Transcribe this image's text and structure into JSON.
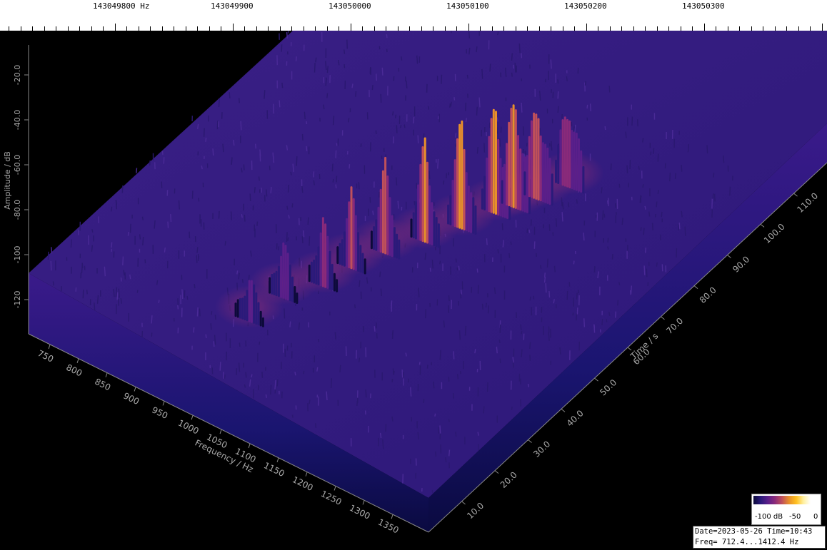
{
  "colors": {
    "background": "#000000",
    "colormap": [
      "#0c0a3a",
      "#2a1a7a",
      "#5a1f8a",
      "#8a2a7a",
      "#c0505a",
      "#e8902a",
      "#ffc020",
      "#fff0a0"
    ]
  },
  "top_axis": {
    "labels": [
      "143049800 Hz",
      "143049900",
      "143050000",
      "143050100",
      "143050200",
      "143050300"
    ]
  },
  "chart_data": {
    "type": "waterfall-3d",
    "title": "",
    "xlabel": "Frequency / Hz",
    "ylabel": "Time / s",
    "zlabel": "Amplitude / dB",
    "x_ticks": [
      "750",
      "800",
      "850",
      "900",
      "950",
      "1000",
      "1050",
      "1100",
      "1150",
      "1200",
      "1250",
      "1300",
      "1350"
    ],
    "y_ticks": [
      "10.0",
      "20.0",
      "30.0",
      "40.0",
      "50.0",
      "60.0",
      "70.0",
      "80.0",
      "90.0",
      "100.0",
      "110.0"
    ],
    "z_ticks": [
      "-20.0",
      "-40.0",
      "-60.0",
      "-80.0",
      "-100",
      "-120"
    ],
    "xlim": [
      712.4,
      1412.4
    ],
    "ylim": [
      0,
      120
    ],
    "zlim": [
      -130,
      0
    ],
    "noise_floor_db": -95,
    "signal_peaks": [
      {
        "freq": 1010,
        "time": 18,
        "db": -70
      },
      {
        "freq": 1020,
        "time": 28,
        "db": -62
      },
      {
        "freq": 1050,
        "time": 36,
        "db": -55
      },
      {
        "freq": 1060,
        "time": 44,
        "db": -48
      },
      {
        "freq": 1080,
        "time": 52,
        "db": -38
      },
      {
        "freq": 1110,
        "time": 60,
        "db": -30
      },
      {
        "freq": 1135,
        "time": 68,
        "db": -22
      },
      {
        "freq": 1155,
        "time": 76,
        "db": -18
      },
      {
        "freq": 1170,
        "time": 80,
        "db": -12
      },
      {
        "freq": 1185,
        "time": 85,
        "db": -20
      },
      {
        "freq": 1205,
        "time": 92,
        "db": -30
      }
    ]
  },
  "legend": {
    "labels": [
      "-100 dB",
      "-50",
      "0"
    ]
  },
  "info": {
    "line1": "Date=2023-05-26 Time=10:43",
    "line2": "Freq= 712.4...1412.4 Hz"
  }
}
